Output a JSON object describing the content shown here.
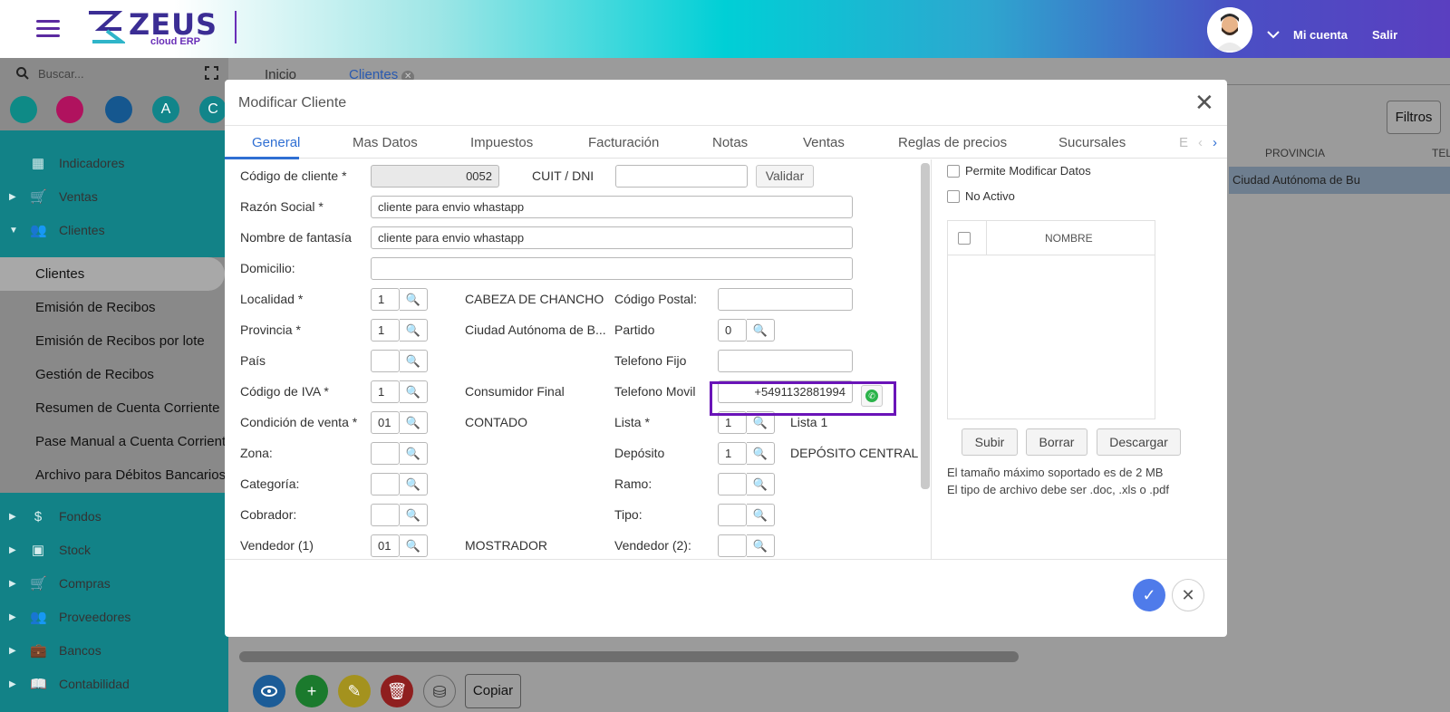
{
  "header": {
    "logo_text": "ZEUS",
    "logo_sub": "cloud ERP",
    "account_label": "Mi cuenta",
    "logout_label": "Salir"
  },
  "sidebar": {
    "search_placeholder": "Buscar...",
    "shortcuts": [
      {
        "label": "",
        "color": "#0e8a86"
      },
      {
        "label": "",
        "color": "#b0125e"
      },
      {
        "label": "",
        "color": "#15578f"
      },
      {
        "label": "A",
        "color": "#11858a"
      },
      {
        "label": "C",
        "color": "#11858a"
      }
    ],
    "items": [
      {
        "label": "Indicadores",
        "icon": "dashboard-icon"
      },
      {
        "label": "Ventas",
        "icon": "cart-icon"
      },
      {
        "label": "Clientes",
        "icon": "people-icon"
      },
      {
        "label": "Fondos",
        "icon": "dollar-icon"
      },
      {
        "label": "Stock",
        "icon": "box-icon"
      },
      {
        "label": "Compras",
        "icon": "cart-plus-icon"
      },
      {
        "label": "Proveedores",
        "icon": "people-icon"
      },
      {
        "label": "Bancos",
        "icon": "briefcase-icon"
      },
      {
        "label": "Contabilidad",
        "icon": "book-icon"
      }
    ],
    "clientes_submenu": [
      "Clientes",
      "Emisión de Recibos",
      "Emisión de Recibos por lote",
      "Gestión de Recibos",
      "Resumen de Cuenta Corriente",
      "Pase Manual a Cuenta Corriente",
      "Archivo para Débitos Bancarios"
    ]
  },
  "main": {
    "tabs": [
      "Inicio",
      "Clientes"
    ],
    "filters_label": "Filtros",
    "grid_columns": [
      "PROVINCIA",
      "TEL"
    ],
    "grid_row_provincia": "Ciudad Autónoma de Bu",
    "copy_label": "Copiar"
  },
  "modal": {
    "title": "Modificar Cliente",
    "tabs": [
      "General",
      "Mas Datos",
      "Impuestos",
      "Facturación",
      "Notas",
      "Ventas",
      "Reglas de precios",
      "Sucursales",
      "E"
    ],
    "labels": {
      "codigo": "Código de cliente *",
      "cuit": "CUIT / DNI",
      "validar": "Validar",
      "razon": "Razón Social *",
      "fantasia": "Nombre de fantasía",
      "domicilio": "Domicilio:",
      "localidad": "Localidad *",
      "provincia": "Provincia *",
      "pais": "País",
      "iva": "Código de IVA *",
      "condicion": "Condición de venta *",
      "zona": "Zona:",
      "categoria": "Categoría:",
      "cobrador": "Cobrador:",
      "vendedor1": "Vendedor (1)",
      "cp": "Código Postal:",
      "partido": "Partido",
      "tel_fijo": "Telefono Fijo",
      "tel_movil": "Telefono Movil",
      "lista": "Lista *",
      "deposito": "Depósito",
      "ramo": "Ramo:",
      "tipo": "Tipo:",
      "vendedor2": "Vendedor (2):"
    },
    "values": {
      "codigo": "0052",
      "cuit": "",
      "razon": "cliente para envio whastapp",
      "fantasia": "cliente para envio whastapp",
      "domicilio": "",
      "localidad_code": "1",
      "localidad_desc": "CABEZA DE CHANCHO",
      "provincia_code": "1",
      "provincia_desc": "Ciudad Autónoma de B...",
      "pais_code": "",
      "iva_code": "1",
      "iva_desc": "Consumidor Final",
      "condicion_code": "01",
      "condicion_desc": "CONTADO",
      "zona_code": "",
      "categoria_code": "",
      "cobrador_code": "",
      "vendedor1_code": "01",
      "vendedor1_desc": "MOSTRADOR",
      "cp": "",
      "partido_code": "0",
      "tel_fijo": "",
      "tel_movil": "+5491132881994",
      "lista_code": "1",
      "lista_desc": "Lista 1",
      "deposito_code": "1",
      "deposito_desc": "DEPÓSITO CENTRAL",
      "ramo_code": "",
      "tipo_code": "",
      "vendedor2_code": ""
    },
    "right": {
      "permite_label": "Permite Modificar Datos",
      "no_activo_label": "No Activo",
      "table_header": "NOMBRE",
      "subir": "Subir",
      "borrar": "Borrar",
      "descargar": "Descargar",
      "note1": "El tamaño máximo soportado es de 2 MB",
      "note2": "El tipo de archivo debe ser .doc, .xls o .pdf"
    }
  }
}
